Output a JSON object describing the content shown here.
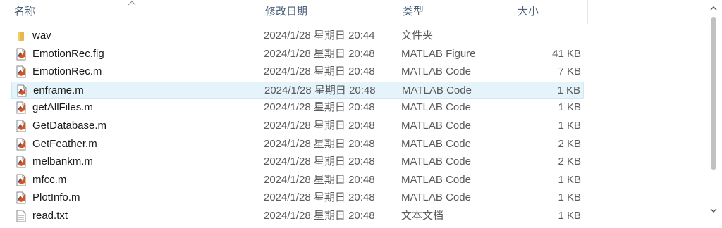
{
  "columns": {
    "name": "名称",
    "modified": "修改日期",
    "type": "类型",
    "size": "大小"
  },
  "files": [
    {
      "name": "wav",
      "modified": "2024/1/28 星期日 20:44",
      "type": "文件夹",
      "size": "",
      "icon": "folder-icon"
    },
    {
      "name": "EmotionRec.fig",
      "modified": "2024/1/28 星期日 20:48",
      "type": "MATLAB Figure",
      "size": "41 KB",
      "icon": "matlab-file-icon"
    },
    {
      "name": "EmotionRec.m",
      "modified": "2024/1/28 星期日 20:48",
      "type": "MATLAB Code",
      "size": "7 KB",
      "icon": "matlab-file-icon"
    },
    {
      "name": "enframe.m",
      "modified": "2024/1/28 星期日 20:48",
      "type": "MATLAB Code",
      "size": "1 KB",
      "icon": "matlab-file-icon",
      "selected": true
    },
    {
      "name": "getAllFiles.m",
      "modified": "2024/1/28 星期日 20:48",
      "type": "MATLAB Code",
      "size": "1 KB",
      "icon": "matlab-file-icon"
    },
    {
      "name": "GetDatabase.m",
      "modified": "2024/1/28 星期日 20:48",
      "type": "MATLAB Code",
      "size": "1 KB",
      "icon": "matlab-file-icon"
    },
    {
      "name": "GetFeather.m",
      "modified": "2024/1/28 星期日 20:48",
      "type": "MATLAB Code",
      "size": "2 KB",
      "icon": "matlab-file-icon"
    },
    {
      "name": "melbankm.m",
      "modified": "2024/1/28 星期日 20:48",
      "type": "MATLAB Code",
      "size": "2 KB",
      "icon": "matlab-file-icon"
    },
    {
      "name": "mfcc.m",
      "modified": "2024/1/28 星期日 20:48",
      "type": "MATLAB Code",
      "size": "1 KB",
      "icon": "matlab-file-icon"
    },
    {
      "name": "PlotInfo.m",
      "modified": "2024/1/28 星期日 20:48",
      "type": "MATLAB Code",
      "size": "1 KB",
      "icon": "matlab-file-icon"
    },
    {
      "name": "read.txt",
      "modified": "2024/1/28 星期日 20:48",
      "type": "文本文档",
      "size": "1 KB",
      "icon": "text-file-icon"
    }
  ]
}
